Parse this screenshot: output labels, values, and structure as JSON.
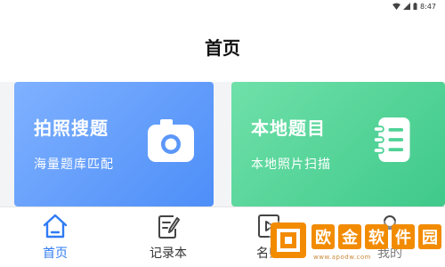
{
  "status_bar": {
    "time": "8:47"
  },
  "header": {
    "title": "首页"
  },
  "cards": [
    {
      "title": "拍照搜题",
      "subtitle": "海量题库匹配",
      "icon": "camera-icon",
      "color": "#5b97fa"
    },
    {
      "title": "本地题目",
      "subtitle": "本地照片扫描",
      "icon": "notebook-icon",
      "color": "#4fd296"
    }
  ],
  "tabs": [
    {
      "label": "首页",
      "icon": "home-icon",
      "active": true
    },
    {
      "label": "记录本",
      "icon": "note-edit-icon",
      "active": false
    },
    {
      "label": "名师",
      "icon": "video-icon",
      "active": false
    },
    {
      "label": "我的",
      "icon": "person-icon",
      "active": false
    }
  ],
  "watermark": {
    "text": [
      "欧",
      "金",
      "软",
      "件",
      "园"
    ],
    "url": "www.apodw.com"
  },
  "colors": {
    "accent": "#2f7bf5",
    "watermark": "#f28b00"
  }
}
